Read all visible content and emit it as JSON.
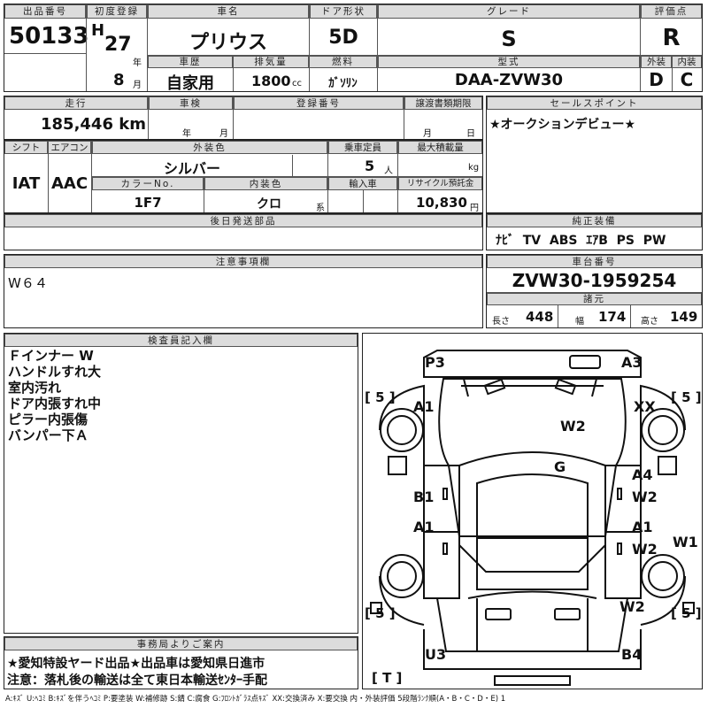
{
  "sheet": {
    "lot_header": "出品番号",
    "lot_number": "50133",
    "first_reg_header": "初度登録",
    "era": "H",
    "year": "27",
    "year_unit": "年",
    "month": "8",
    "month_unit": "月",
    "car_name_header": "車名",
    "car_name": "プリウス",
    "door_header": "ドア形状",
    "door": "5D",
    "grade_header": "グレード",
    "grade": "S",
    "score_header": "評価点",
    "score": "R",
    "history_header": "車歴",
    "history": "自家用",
    "displacement_header": "排気量",
    "displacement": "1800",
    "displacement_unit": "cc",
    "fuel_header": "燃料",
    "fuel": "ｶﾞｿﾘﾝ",
    "model_header": "型式",
    "model": "DAA-ZVW30",
    "exterior_header": "外装",
    "exterior_grade": "D",
    "interior_header": "内装",
    "interior_grade": "C"
  },
  "row2": {
    "mileage_header": "走行",
    "mileage": "185,446",
    "mileage_unit": "km",
    "inspection_header": "車検",
    "insp_year_unit": "年",
    "insp_month_unit": "月",
    "reg_no_header": "登録番号",
    "transfer_header": "譲渡書類期限",
    "transfer_month_unit": "月",
    "transfer_day_unit": "日",
    "sales_point_header": "セールスポイント",
    "sales_point": "★オークションデビュー★"
  },
  "row3": {
    "shift_header": "シフト",
    "shift": "IAT",
    "ac_header": "エアコン",
    "ac": "AAC",
    "ext_color_header": "外装色",
    "ext_color": "シルバー",
    "capacity_header": "乗車定員",
    "capacity": "5",
    "capacity_unit": "人",
    "max_load_header": "最大積載量",
    "max_load_unit": "kg",
    "color_no_header": "カラーNo.",
    "color_no": "1F7",
    "int_color_header": "内装色",
    "int_color": "クロ",
    "int_color_unit": "系",
    "import_header": "輸入車",
    "recycle_header": "リサイクル預託金",
    "recycle": "10,830",
    "recycle_unit": "円"
  },
  "later_parts_header": "後日発送部品",
  "equipment": {
    "header": "純正装備",
    "items": "ﾅﾋﾞ  TV  ABS  ｴｱB  PS  PW"
  },
  "notes": {
    "header": "注意事項欄",
    "text": "W６４"
  },
  "chassis": {
    "header": "車台番号",
    "number": "ZVW30-1959254",
    "spec_header": "諸元",
    "length_label": "長さ",
    "length": "448",
    "width_label": "幅",
    "width": "174",
    "height_label": "高さ",
    "height": "149"
  },
  "inspector": {
    "header": "検査員記入欄",
    "lines": [
      "Ｆインナー W",
      "ハンドルすれ大",
      "室内汚れ",
      "ドア内張すれ中",
      "ピラー内張傷",
      "バンパー下Ａ"
    ]
  },
  "office": {
    "header": "事務局よりご案内",
    "line1": "★愛知特設ヤード出品★出品車は愛知県日進市",
    "line2": "注意：落札後の輸送は全て東日本輸送ｾﾝﾀｰ手配"
  },
  "diagram": {
    "labels": {
      "p3": "P3",
      "a3": "A3",
      "a1_front": "A1",
      "xx": "XX",
      "w2_hood": "W2",
      "g": "G",
      "a4": "A4",
      "w2_r1": "W2",
      "b1": "B1",
      "a1_l": "A1",
      "a1_r": "A1",
      "w2_r2": "W2",
      "w1": "W1",
      "w2_rear": "W2",
      "u3": "U3",
      "b4": "B4"
    },
    "tire_fl": "[ 5 ]",
    "tire_fr": "[ 5 ]",
    "tire_rl": "[ 5 ]",
    "tire_rr": "[ 5 ]",
    "tire_spare": "[ T ]"
  },
  "legend": "A:ｷｽﾞ U:ﾍｺﾐ B:ｷｽﾞを伴うﾍｺﾐ P:要塗装 W:補修跡 S:錆 C:腐食 G:ﾌﾛﾝﾄｶﾞﾗｽ点ｷｽﾞ XX:交換済み X:要交換  内・外装評価 5段階ﾗﾝｸ順(A・B・C・D・E) 1"
}
